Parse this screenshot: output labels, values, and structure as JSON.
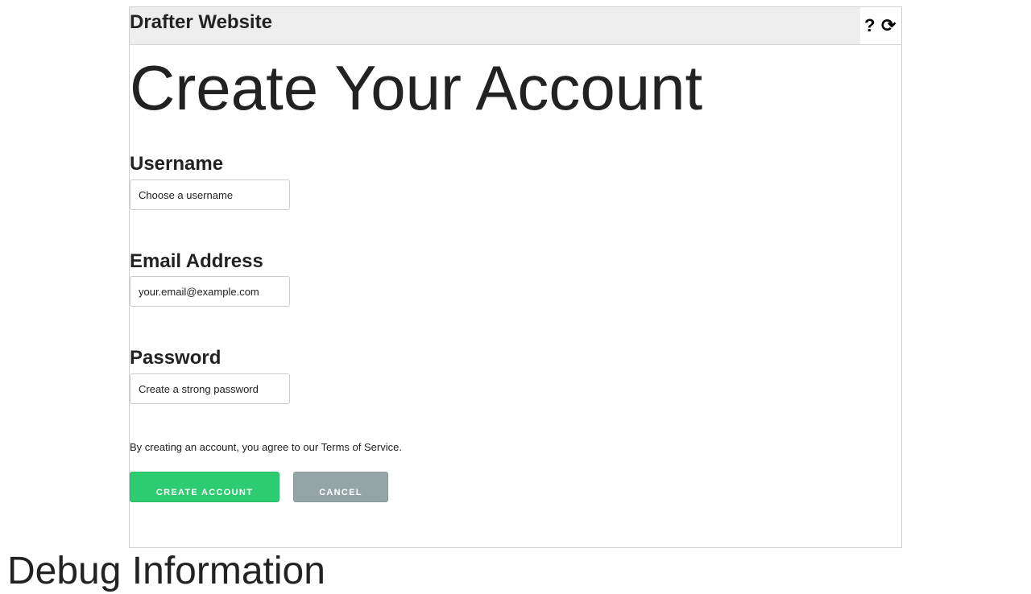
{
  "header": {
    "site_title": "Drafter Website",
    "help_icon": "?",
    "refresh_icon": "⟳"
  },
  "page": {
    "title": "Create Your Account"
  },
  "form": {
    "username": {
      "label": "Username",
      "placeholder": "Choose a username",
      "value": ""
    },
    "email": {
      "label": "Email Address",
      "placeholder": "your.email@example.com",
      "value": ""
    },
    "password": {
      "label": "Password",
      "placeholder": "Create a strong password",
      "value": ""
    },
    "terms_text": "By creating an account, you agree to our Terms of Service.",
    "create_label": "Create Account",
    "cancel_label": "Cancel"
  },
  "debug": {
    "title": "Debug Information"
  },
  "colors": {
    "primary_button": "#2ecc71",
    "secondary_button": "#95a5a6",
    "header_background": "#eeeeee"
  },
  "icons": {
    "help": "question-icon",
    "refresh": "refresh-icon"
  }
}
